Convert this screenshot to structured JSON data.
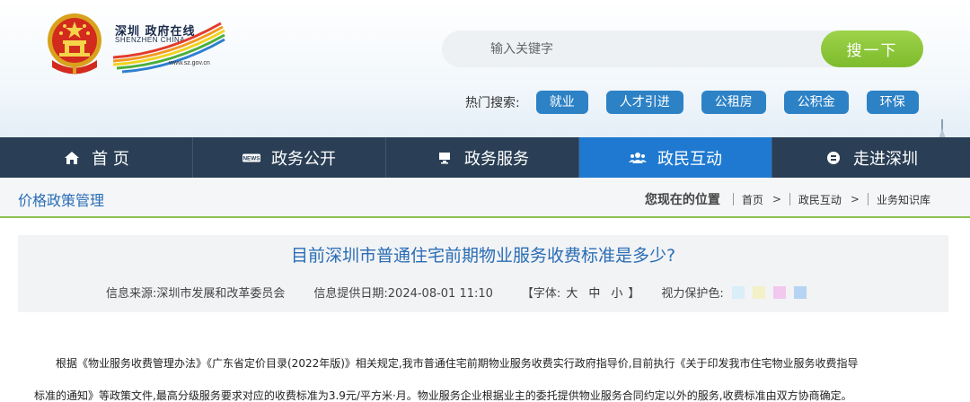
{
  "header": {
    "logo_cn": "深圳 政府在线",
    "logo_en": "SHENZHEN CHINA",
    "logo_url": "www.sz.gov.cn",
    "search": {
      "placeholder": "输入关键字",
      "button_label": "搜一下"
    },
    "hot_label": "热门搜索:",
    "hot_tags": [
      "就业",
      "人才引进",
      "公租房",
      "公积金",
      "环保"
    ]
  },
  "nav": {
    "items": [
      {
        "label": "首 页",
        "icon": "home-icon",
        "active": false
      },
      {
        "label": "政务公开",
        "icon": "news-icon",
        "active": false
      },
      {
        "label": "政务服务",
        "icon": "monitor-icon",
        "active": false
      },
      {
        "label": "政民互动",
        "icon": "users-icon",
        "active": true
      },
      {
        "label": "走进深圳",
        "icon": "info-circle-icon",
        "active": false
      }
    ]
  },
  "breadcrumb": {
    "section_title": "价格政策管理",
    "here_label": "您现在的位置",
    "items": [
      "首页",
      "政民互动",
      "业务知识库"
    ],
    "arrow": ">"
  },
  "article": {
    "title": "目前深圳市普通住宅前期物业服务收费标准是多少?",
    "source": "信息来源:深圳市发展和改革委员会",
    "date": "信息提供日期:2024-08-01 11:10",
    "font_label_open": "【字体:",
    "font_sizes": [
      "大",
      "中",
      "小"
    ],
    "font_label_close": "】",
    "eye_label": "视力保护色:",
    "eye_colors": [
      "#d9eef8",
      "#f4f0c8",
      "#f1c8ee",
      "#b6d3f3"
    ],
    "body_line1": "根据《物业服务收费管理办法》《广东省定价目录(2022年版)》相关规定,我市普通住宅前期物业服务收费实行政府指导价,目前执行《关于印发我市住宅物业服务收费指导",
    "body_line2": "标准的通知》等政策文件,最高分级服务要求对应的收费标准为3.9元/平方米·月。物业服务企业根据业主的委托提供物业服务合同约定以外的服务,收费标准由双方协商确定。"
  },
  "colors": {
    "nav_bg": "#2a3f55",
    "nav_active": "#1f79d0",
    "search_button": "#8cc63f",
    "hot_tag": "#2d82c6",
    "title_blue": "#2a6db5",
    "crumb_border": "#8cc253"
  }
}
